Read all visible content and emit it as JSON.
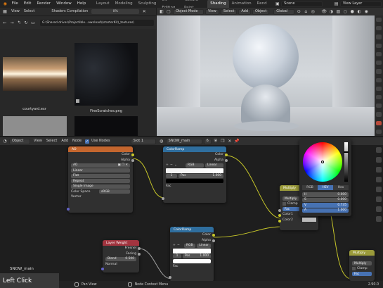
{
  "topbar": {
    "menus": [
      "File",
      "Edit",
      "Render",
      "Window",
      "Help"
    ],
    "workspaces": [
      "Layout",
      "Modeling",
      "Sculpting",
      "UV Editing",
      "Texture Paint",
      "Shading",
      "Animation",
      "Rend"
    ],
    "active_workspace": "Shading",
    "scene": "Scene",
    "view_layer": "View Layer"
  },
  "file_browser": {
    "view": "View",
    "select": "Select",
    "progress_label": "Shaders Compilation",
    "progress_text": "0%",
    "progress_fraction": 0.0,
    "path": "G:\\Shared drives\\Projectible...ownload\\(starterKit)_textures\\",
    "thumbs": [
      {
        "label": "courtyard.exr"
      },
      {
        "label": "FineScratches.png"
      },
      {
        "label": ""
      },
      {
        "label": ""
      }
    ]
  },
  "viewport": {
    "mode": "Object Mode",
    "menus": [
      "View",
      "Select",
      "Add",
      "Object"
    ],
    "orientation": "Global"
  },
  "node_editor": {
    "menus": [
      "Object",
      "View",
      "Select",
      "Add",
      "Node"
    ],
    "use_nodes_label": "Use Nodes",
    "slot": "Slot 1",
    "material": "SNOW_main",
    "user_count": "6",
    "material_label": "SNOW_main",
    "hint_left": "Left Click",
    "status_pan": "Pan View",
    "status_ctx": "Node Context Menu",
    "version": "2.90.0"
  },
  "nodes": {
    "ao": {
      "title": "AO",
      "out_color": "Color",
      "out_alpha": "Alpha",
      "image": "AO",
      "interp": "Linear",
      "proj": "Flat",
      "ext": "Repeat",
      "source": "Single Image",
      "colorspace_label": "Color Space",
      "colorspace": "sRGB",
      "vector": "Vector"
    },
    "ramp1": {
      "title": "ColorRamp",
      "out_color": "Color",
      "out_alpha": "Alpha",
      "mode": "RGB",
      "interp": "Linear",
      "index": "1",
      "pos_label": "Pos",
      "pos": "1.000",
      "fac": "Fac"
    },
    "layer_weight": {
      "title": "Layer Weight",
      "out_fresnel": "Fresnel",
      "out_facing": "Facing",
      "blend_label": "Blend",
      "blend": "0.500",
      "normal": "Normal"
    },
    "ramp2": {
      "title": "ColorRamp",
      "out_color": "Color",
      "out_alpha": "Alpha",
      "mode": "RGB",
      "interp": "Linear",
      "index": "1",
      "pos_label": "Pos",
      "pos": "1.000",
      "fac": "Fac"
    },
    "multiply1": {
      "title": "Multiply",
      "out": "Color",
      "op": "Multiply",
      "clamp": "Clamp",
      "fac": "Fac",
      "c1": "Color1",
      "c2": "Color2"
    },
    "multiply2": {
      "title": "Multiply",
      "op": "Multiply",
      "clamp": "Clamp",
      "fac": "Fac"
    }
  },
  "color_picker": {
    "tabs": [
      "RGB",
      "HSV",
      "Hex"
    ],
    "active_tab": "HSV",
    "rows": [
      {
        "label": "H",
        "value": "0.000"
      },
      {
        "label": "S",
        "value": "0.000"
      },
      {
        "label": "V",
        "value": "0.735"
      },
      {
        "label": "A",
        "value": "1.000"
      }
    ]
  },
  "colors": {
    "accent": "#4772b3",
    "texture_header": "#c4662e",
    "converter_header": "#2f6e9e",
    "input_header": "#a2343f",
    "color_header": "#9a9a3a"
  }
}
